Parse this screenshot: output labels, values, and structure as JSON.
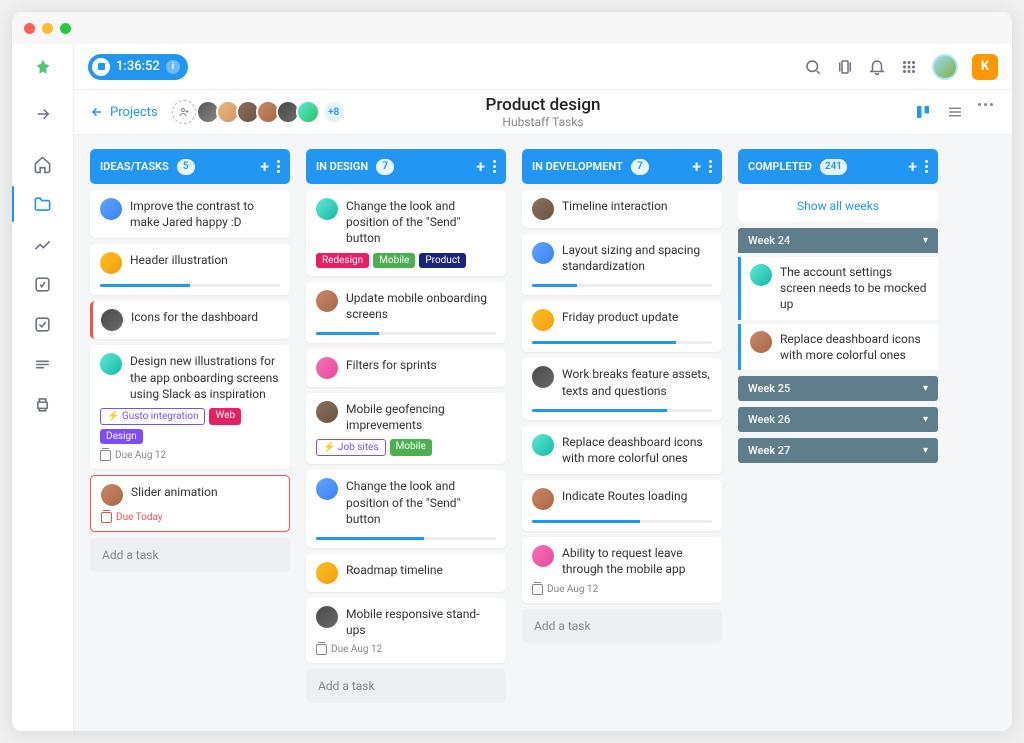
{
  "timer": {
    "time": "1:36:52"
  },
  "topbar_badge": "K",
  "header": {
    "back_label": "Projects",
    "title": "Product design",
    "subtitle": "Hubstaff Tasks",
    "avatars_more": "+8"
  },
  "columns": [
    {
      "title": "IDEAS/TASKS",
      "count": "5",
      "cards": [
        {
          "text": "Improve the contrast to make Jared happy :D"
        },
        {
          "text": "Header illustration",
          "progress": 50
        },
        {
          "text": "Icons for the dashboard",
          "accent": "red"
        },
        {
          "text": "Design new illustrations for the app onboarding screens using Slack as inspiration",
          "tags": [
            {
              "label": "Gusto integration",
              "bg": "#fff",
              "color": "#7c4dff"
            },
            {
              "label": "Web",
              "bg": "#e91e63",
              "color": "#fff"
            },
            {
              "label": "Design",
              "bg": "#7c4dff",
              "color": "#fff"
            }
          ],
          "due": "Due Aug 12"
        },
        {
          "text": "Slider animation",
          "selected": true,
          "due": "Due Today",
          "due_red": true
        }
      ],
      "add_label": "Add a task"
    },
    {
      "title": "IN DESIGN",
      "count": "7",
      "cards": [
        {
          "text": "Change the look and position of the \"Send\" button",
          "tags": [
            {
              "label": "Redesign",
              "bg": "#e91e63",
              "color": "#fff"
            },
            {
              "label": "Mobile",
              "bg": "#4caf50",
              "color": "#fff"
            },
            {
              "label": "Product",
              "bg": "#1a237e",
              "color": "#fff"
            }
          ]
        },
        {
          "text": "Update mobile onboarding screens",
          "progress": 35
        },
        {
          "text": "Filters for sprints"
        },
        {
          "text": "Mobile geofencing imprevements",
          "tags": [
            {
              "label": "Job sites",
              "bg": "#fff",
              "color": "#7c4dff"
            },
            {
              "label": "Mobile",
              "bg": "#4caf50",
              "color": "#fff"
            }
          ]
        },
        {
          "text": "Change the look and position of the \"Send\" button",
          "progress": 60
        },
        {
          "text": "Roadmap timeline"
        },
        {
          "text": "Mobile responsive stand-ups",
          "due": "Due Aug 12"
        }
      ],
      "add_label": "Add a task"
    },
    {
      "title": "IN DEVELOPMENT",
      "count": "7",
      "cards": [
        {
          "text": "Timeline interaction"
        },
        {
          "text": "Layout sizing and spacing standardization",
          "progress": 25
        },
        {
          "text": "Friday product update",
          "progress": 80
        },
        {
          "text": "Work breaks feature assets, texts and questions",
          "progress": 75
        },
        {
          "text": "Replace deashboard icons with more colorful ones"
        },
        {
          "text": "Indicate Routes loading",
          "progress": 60
        },
        {
          "text": "Ability to request leave through the mobile app",
          "due": "Due Aug 12"
        }
      ],
      "add_label": "Add a task"
    },
    {
      "title": "COMPLETED",
      "count": "241",
      "show_all": "Show all weeks",
      "weeks": [
        {
          "label": "Week 24",
          "open": true,
          "cards": [
            {
              "text": "The account settings screen needs to be mocked up"
            },
            {
              "text": "Replace deashboard icons with more colorful ones"
            }
          ]
        },
        {
          "label": "Week 25"
        },
        {
          "label": "Week 26"
        },
        {
          "label": "Week 27"
        }
      ]
    }
  ]
}
